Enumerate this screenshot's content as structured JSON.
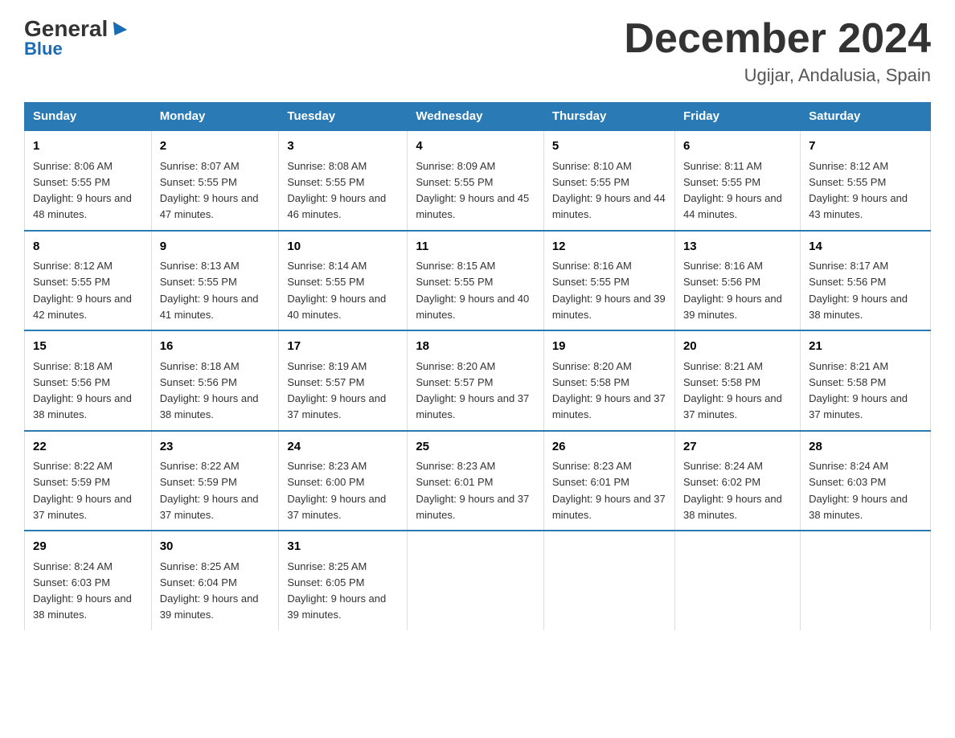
{
  "logo": {
    "general": "General",
    "blue": "Blue"
  },
  "title": "December 2024",
  "subtitle": "Ugijar, Andalusia, Spain",
  "days_header": [
    "Sunday",
    "Monday",
    "Tuesday",
    "Wednesday",
    "Thursday",
    "Friday",
    "Saturday"
  ],
  "weeks": [
    [
      {
        "num": "1",
        "sunrise": "8:06 AM",
        "sunset": "5:55 PM",
        "daylight": "9 hours and 48 minutes."
      },
      {
        "num": "2",
        "sunrise": "8:07 AM",
        "sunset": "5:55 PM",
        "daylight": "9 hours and 47 minutes."
      },
      {
        "num": "3",
        "sunrise": "8:08 AM",
        "sunset": "5:55 PM",
        "daylight": "9 hours and 46 minutes."
      },
      {
        "num": "4",
        "sunrise": "8:09 AM",
        "sunset": "5:55 PM",
        "daylight": "9 hours and 45 minutes."
      },
      {
        "num": "5",
        "sunrise": "8:10 AM",
        "sunset": "5:55 PM",
        "daylight": "9 hours and 44 minutes."
      },
      {
        "num": "6",
        "sunrise": "8:11 AM",
        "sunset": "5:55 PM",
        "daylight": "9 hours and 44 minutes."
      },
      {
        "num": "7",
        "sunrise": "8:12 AM",
        "sunset": "5:55 PM",
        "daylight": "9 hours and 43 minutes."
      }
    ],
    [
      {
        "num": "8",
        "sunrise": "8:12 AM",
        "sunset": "5:55 PM",
        "daylight": "9 hours and 42 minutes."
      },
      {
        "num": "9",
        "sunrise": "8:13 AM",
        "sunset": "5:55 PM",
        "daylight": "9 hours and 41 minutes."
      },
      {
        "num": "10",
        "sunrise": "8:14 AM",
        "sunset": "5:55 PM",
        "daylight": "9 hours and 40 minutes."
      },
      {
        "num": "11",
        "sunrise": "8:15 AM",
        "sunset": "5:55 PM",
        "daylight": "9 hours and 40 minutes."
      },
      {
        "num": "12",
        "sunrise": "8:16 AM",
        "sunset": "5:55 PM",
        "daylight": "9 hours and 39 minutes."
      },
      {
        "num": "13",
        "sunrise": "8:16 AM",
        "sunset": "5:56 PM",
        "daylight": "9 hours and 39 minutes."
      },
      {
        "num": "14",
        "sunrise": "8:17 AM",
        "sunset": "5:56 PM",
        "daylight": "9 hours and 38 minutes."
      }
    ],
    [
      {
        "num": "15",
        "sunrise": "8:18 AM",
        "sunset": "5:56 PM",
        "daylight": "9 hours and 38 minutes."
      },
      {
        "num": "16",
        "sunrise": "8:18 AM",
        "sunset": "5:56 PM",
        "daylight": "9 hours and 38 minutes."
      },
      {
        "num": "17",
        "sunrise": "8:19 AM",
        "sunset": "5:57 PM",
        "daylight": "9 hours and 37 minutes."
      },
      {
        "num": "18",
        "sunrise": "8:20 AM",
        "sunset": "5:57 PM",
        "daylight": "9 hours and 37 minutes."
      },
      {
        "num": "19",
        "sunrise": "8:20 AM",
        "sunset": "5:58 PM",
        "daylight": "9 hours and 37 minutes."
      },
      {
        "num": "20",
        "sunrise": "8:21 AM",
        "sunset": "5:58 PM",
        "daylight": "9 hours and 37 minutes."
      },
      {
        "num": "21",
        "sunrise": "8:21 AM",
        "sunset": "5:58 PM",
        "daylight": "9 hours and 37 minutes."
      }
    ],
    [
      {
        "num": "22",
        "sunrise": "8:22 AM",
        "sunset": "5:59 PM",
        "daylight": "9 hours and 37 minutes."
      },
      {
        "num": "23",
        "sunrise": "8:22 AM",
        "sunset": "5:59 PM",
        "daylight": "9 hours and 37 minutes."
      },
      {
        "num": "24",
        "sunrise": "8:23 AM",
        "sunset": "6:00 PM",
        "daylight": "9 hours and 37 minutes."
      },
      {
        "num": "25",
        "sunrise": "8:23 AM",
        "sunset": "6:01 PM",
        "daylight": "9 hours and 37 minutes."
      },
      {
        "num": "26",
        "sunrise": "8:23 AM",
        "sunset": "6:01 PM",
        "daylight": "9 hours and 37 minutes."
      },
      {
        "num": "27",
        "sunrise": "8:24 AM",
        "sunset": "6:02 PM",
        "daylight": "9 hours and 38 minutes."
      },
      {
        "num": "28",
        "sunrise": "8:24 AM",
        "sunset": "6:03 PM",
        "daylight": "9 hours and 38 minutes."
      }
    ],
    [
      {
        "num": "29",
        "sunrise": "8:24 AM",
        "sunset": "6:03 PM",
        "daylight": "9 hours and 38 minutes."
      },
      {
        "num": "30",
        "sunrise": "8:25 AM",
        "sunset": "6:04 PM",
        "daylight": "9 hours and 39 minutes."
      },
      {
        "num": "31",
        "sunrise": "8:25 AM",
        "sunset": "6:05 PM",
        "daylight": "9 hours and 39 minutes."
      },
      null,
      null,
      null,
      null
    ]
  ]
}
